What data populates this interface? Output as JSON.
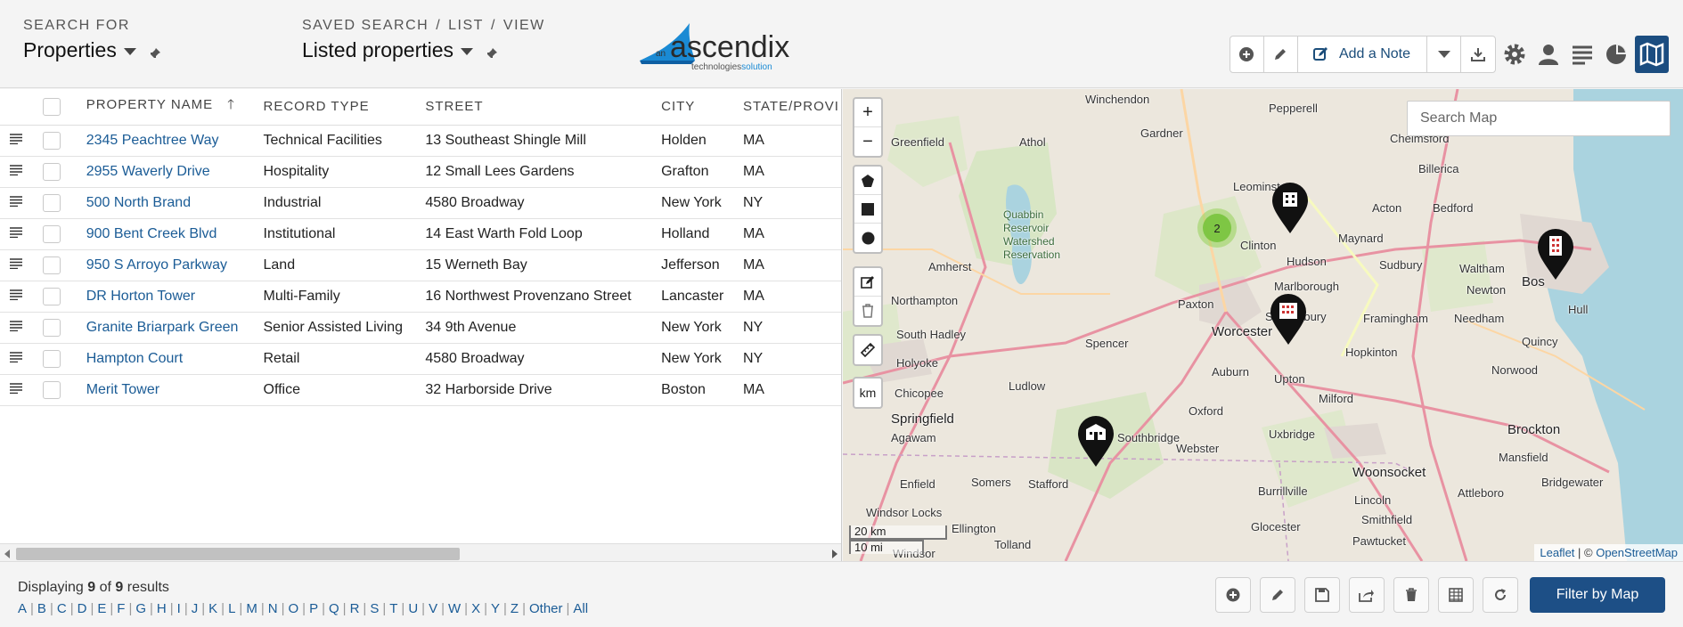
{
  "header": {
    "search_for_caption": "SEARCH FOR",
    "search_for_value": "Properties",
    "saved_search_caption": [
      "SAVED SEARCH",
      "LIST",
      "VIEW"
    ],
    "saved_search_value": "Listed properties",
    "logo_prefix": "an",
    "logo_name": "ascendix",
    "logo_tagline": "technologies",
    "logo_tagline_accent": "solution",
    "add_note_label": "Add a Note"
  },
  "table": {
    "columns": [
      "PROPERTY NAME",
      "RECORD TYPE",
      "STREET",
      "CITY",
      "STATE/PROVI"
    ],
    "rows": [
      {
        "name": "2345 Peachtree Way",
        "type": "Technical Facilities",
        "street": "13 Southeast Shingle Mill",
        "city": "Holden",
        "state": "MA"
      },
      {
        "name": "2955 Waverly Drive",
        "type": "Hospitality",
        "street": "12 Small Lees Gardens",
        "city": "Grafton",
        "state": "MA"
      },
      {
        "name": "500 North Brand",
        "type": "Industrial",
        "street": "4580 Broadway",
        "city": "New York",
        "state": "NY"
      },
      {
        "name": "900 Bent Creek Blvd",
        "type": "Institutional",
        "street": "14 East Warth Fold Loop",
        "city": "Holland",
        "state": "MA"
      },
      {
        "name": "950 S Arroyo Parkway",
        "type": "Land",
        "street": "15 Werneth Bay",
        "city": "Jefferson",
        "state": "MA"
      },
      {
        "name": "DR Horton Tower",
        "type": "Multi-Family",
        "street": "16 Northwest Provenzano Street",
        "city": "Lancaster",
        "state": "MA"
      },
      {
        "name": "Granite Briarpark Green",
        "type": "Senior Assisted Living",
        "street": "34 9th Avenue",
        "city": "New York",
        "state": "NY"
      },
      {
        "name": "Hampton Court",
        "type": "Retail",
        "street": "4580 Broadway",
        "city": "New York",
        "state": "NY"
      },
      {
        "name": "Merit Tower",
        "type": "Office",
        "street": "32 Harborside Drive",
        "city": "Boston",
        "state": "MA"
      }
    ]
  },
  "map": {
    "search_placeholder": "Search Map",
    "zoom_in": "+",
    "zoom_out": "−",
    "measure_unit": "km",
    "cluster_count": "2",
    "scale_km": "20 km",
    "scale_mi": "10 mi",
    "attribution_leaflet": "Leaflet",
    "attribution_sep": " | © ",
    "attribution_osm": "OpenStreetMap",
    "towns": [
      "Winchendon",
      "Pepperell",
      "Greenfield",
      "Athol",
      "Gardner",
      "Leominster",
      "Chelmsford",
      "Billerica",
      "Quabbin Reservoir Watershed Reservation",
      "Amherst",
      "Clinton",
      "Acton",
      "Bedford",
      "Maynard",
      "Hudson",
      "Sudbury",
      "Waltham",
      "Northampton",
      "Paxton",
      "Marlborough",
      "Newton",
      "Bos",
      "Worcester",
      "Shrewsbury",
      "Framingham",
      "Needham",
      "Hull",
      "South Hadley",
      "Spencer",
      "Hopkinton",
      "Quincy",
      "Holyoke",
      "Auburn",
      "Upton",
      "Norwood",
      "Ludlow",
      "Chicopee",
      "Oxford",
      "Milford",
      "Springfield",
      "Agawam",
      "Southbridge",
      "Webster",
      "Uxbridge",
      "Brockton",
      "Woonsocket",
      "Mansfield",
      "Enfield",
      "Somers",
      "Stafford",
      "Burrillville",
      "Lincoln",
      "Attleboro",
      "Bridgewater",
      "Windsor Locks",
      "Ellington",
      "Glocester",
      "Smithfield",
      "Tolland",
      "Pawtucket",
      "Windsor"
    ]
  },
  "footer": {
    "display_prefix": "Displaying",
    "display_shown": "9",
    "display_of": "of",
    "display_total": "9",
    "display_suffix": "results",
    "letters": [
      "A",
      "B",
      "C",
      "D",
      "E",
      "F",
      "G",
      "H",
      "I",
      "J",
      "K",
      "L",
      "M",
      "N",
      "O",
      "P",
      "Q",
      "R",
      "S",
      "T",
      "U",
      "V",
      "W",
      "X",
      "Y",
      "Z",
      "Other",
      "All"
    ],
    "filter_button": "Filter by Map"
  },
  "colors": {
    "accent": "#1d4f86",
    "link": "#1b5c96",
    "cluster": "#7fc83c"
  }
}
